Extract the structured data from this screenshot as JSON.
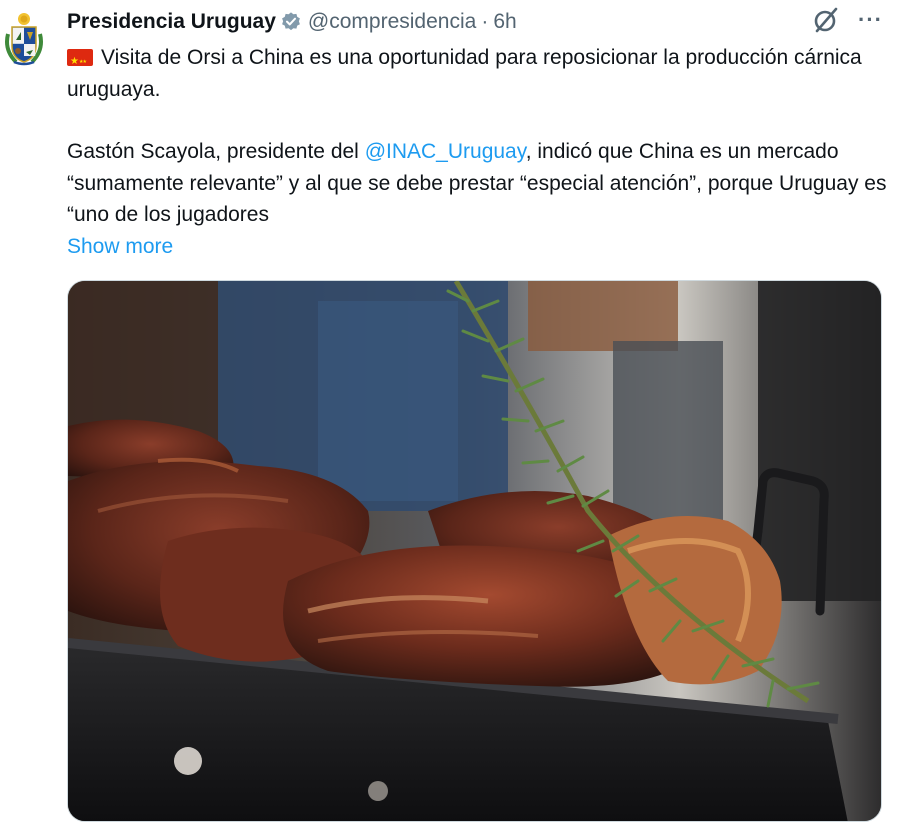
{
  "author": {
    "display_name": "Presidencia Uruguay",
    "handle": "@compresidencia",
    "separator": "·",
    "time": "6h",
    "avatar_icon": "uruguay-coat-of-arms-icon",
    "verified_icon": "verified-badge-icon"
  },
  "actions": {
    "grok_icon": "grok-icon",
    "more_label": "···"
  },
  "post": {
    "flag_icon": "china-flag-icon",
    "line1": "Visita de Orsi a China es una oportunidad para reposicionar la producción cárnica uruguaya.",
    "para2_before": "Gastón Scayola, presidente del ",
    "mention": "@INAC_Uruguay",
    "para2_after": ", indicó que China es un mercado “sumamente relevante” y al que se debe prestar “especial atención”, porque Uruguay es “uno de los jugadores",
    "show_more": "Show more"
  },
  "media": {
    "alt_icon": "grilled-meat-photo"
  },
  "colors": {
    "link": "#1d9bf0",
    "secondary_text": "#536471",
    "verified": "#829aab"
  }
}
